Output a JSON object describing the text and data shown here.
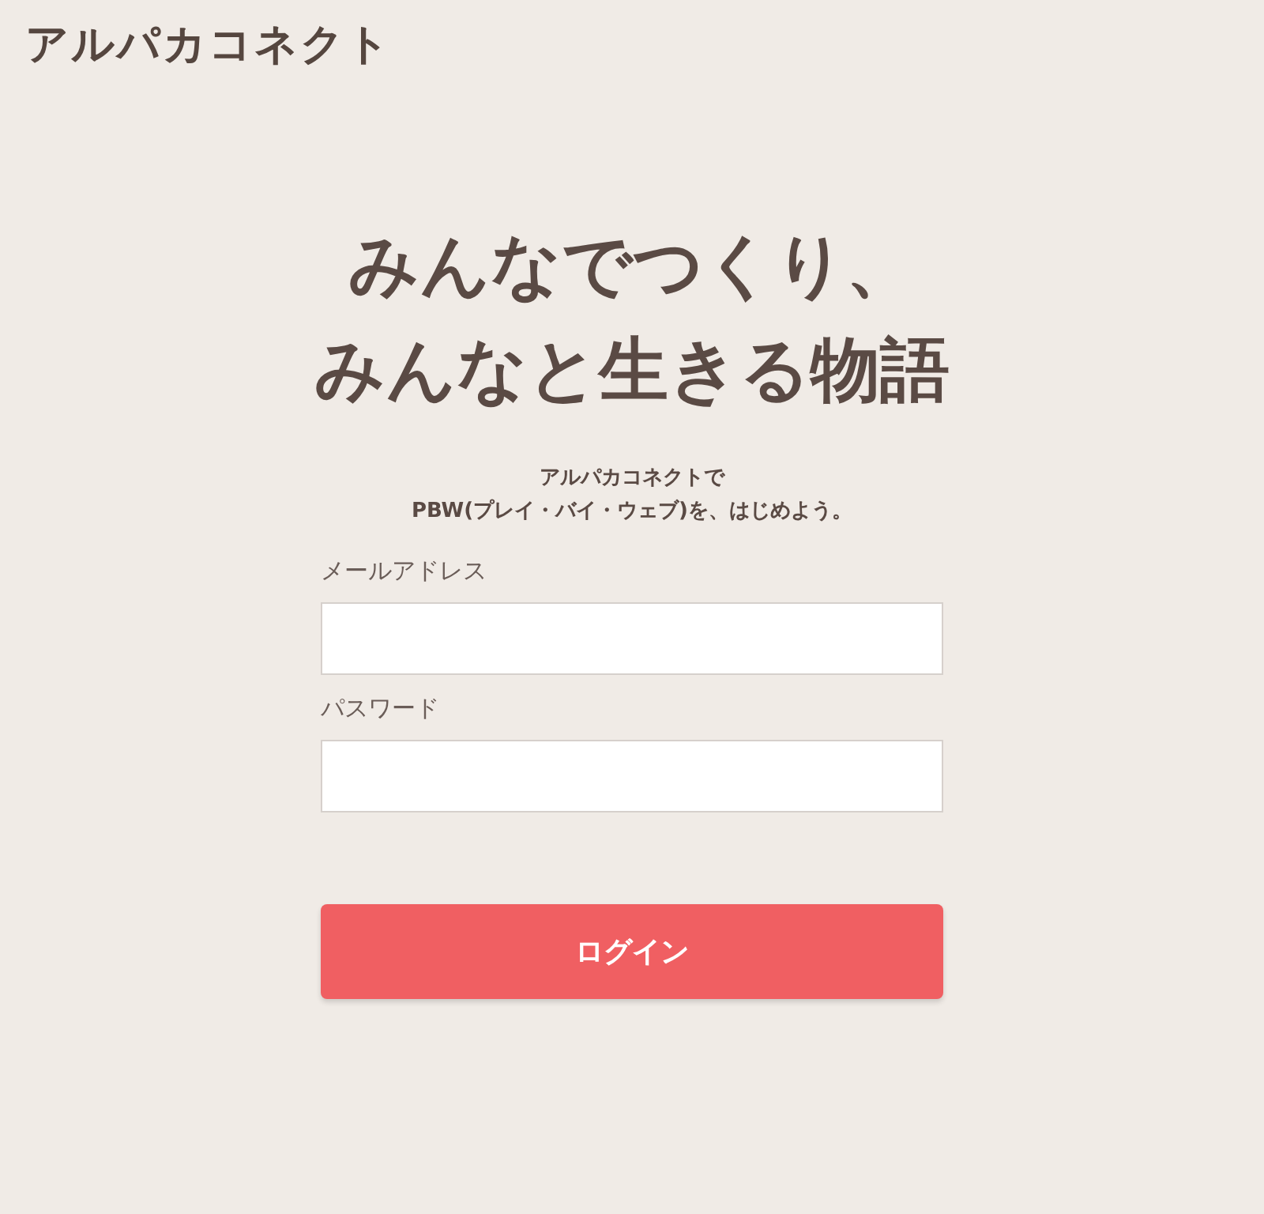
{
  "logo": "アルパカコネクト",
  "headline": [
    "みんなでつくり、",
    "みんなと生きる物語"
  ],
  "lead": [
    "アルパカコネクトで",
    "PBW(プレイ・バイ・ウェブ)を、はじめよう。"
  ],
  "fields": [
    {
      "label": "メールアドレス"
    },
    {
      "label": "パスワード"
    }
  ],
  "submit": "ログイン"
}
